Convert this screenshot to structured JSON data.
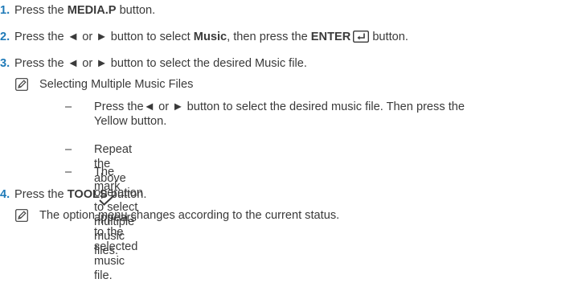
{
  "steps": [
    {
      "num": "1.",
      "pre": "Press the ",
      "bold": "MEDIA.P",
      "post": " button."
    },
    {
      "num": "2.",
      "a": "Press the ",
      "arrows": "◄ or ►",
      "b": " button to select ",
      "bold1": "Music",
      "c": ", then press the ",
      "bold2": "ENTER",
      "d": " button."
    },
    {
      "num": "3.",
      "text": "Press the ◄ or ► button to select the desired Music file."
    },
    {
      "num": "4.",
      "pre": "Press the ",
      "bold": "TOOLS",
      "post": " button."
    }
  ],
  "note1": {
    "icon": "note-icon",
    "text": "Selecting Multiple Music Files"
  },
  "subitems": [
    {
      "dash": "–",
      "line1": "Press the◄ or ► button to select the desired music file. Then press the",
      "line2": "Yellow button."
    },
    {
      "dash": "–",
      "text": "Repeat the above operation to select multiple music files."
    },
    {
      "dash": "–",
      "pre": "The mark",
      "icon": "checkmark-icon",
      "post": "appears to the selected music file."
    }
  ],
  "note2": {
    "icon": "note-icon",
    "text": "The option menu changes according to the current status."
  }
}
